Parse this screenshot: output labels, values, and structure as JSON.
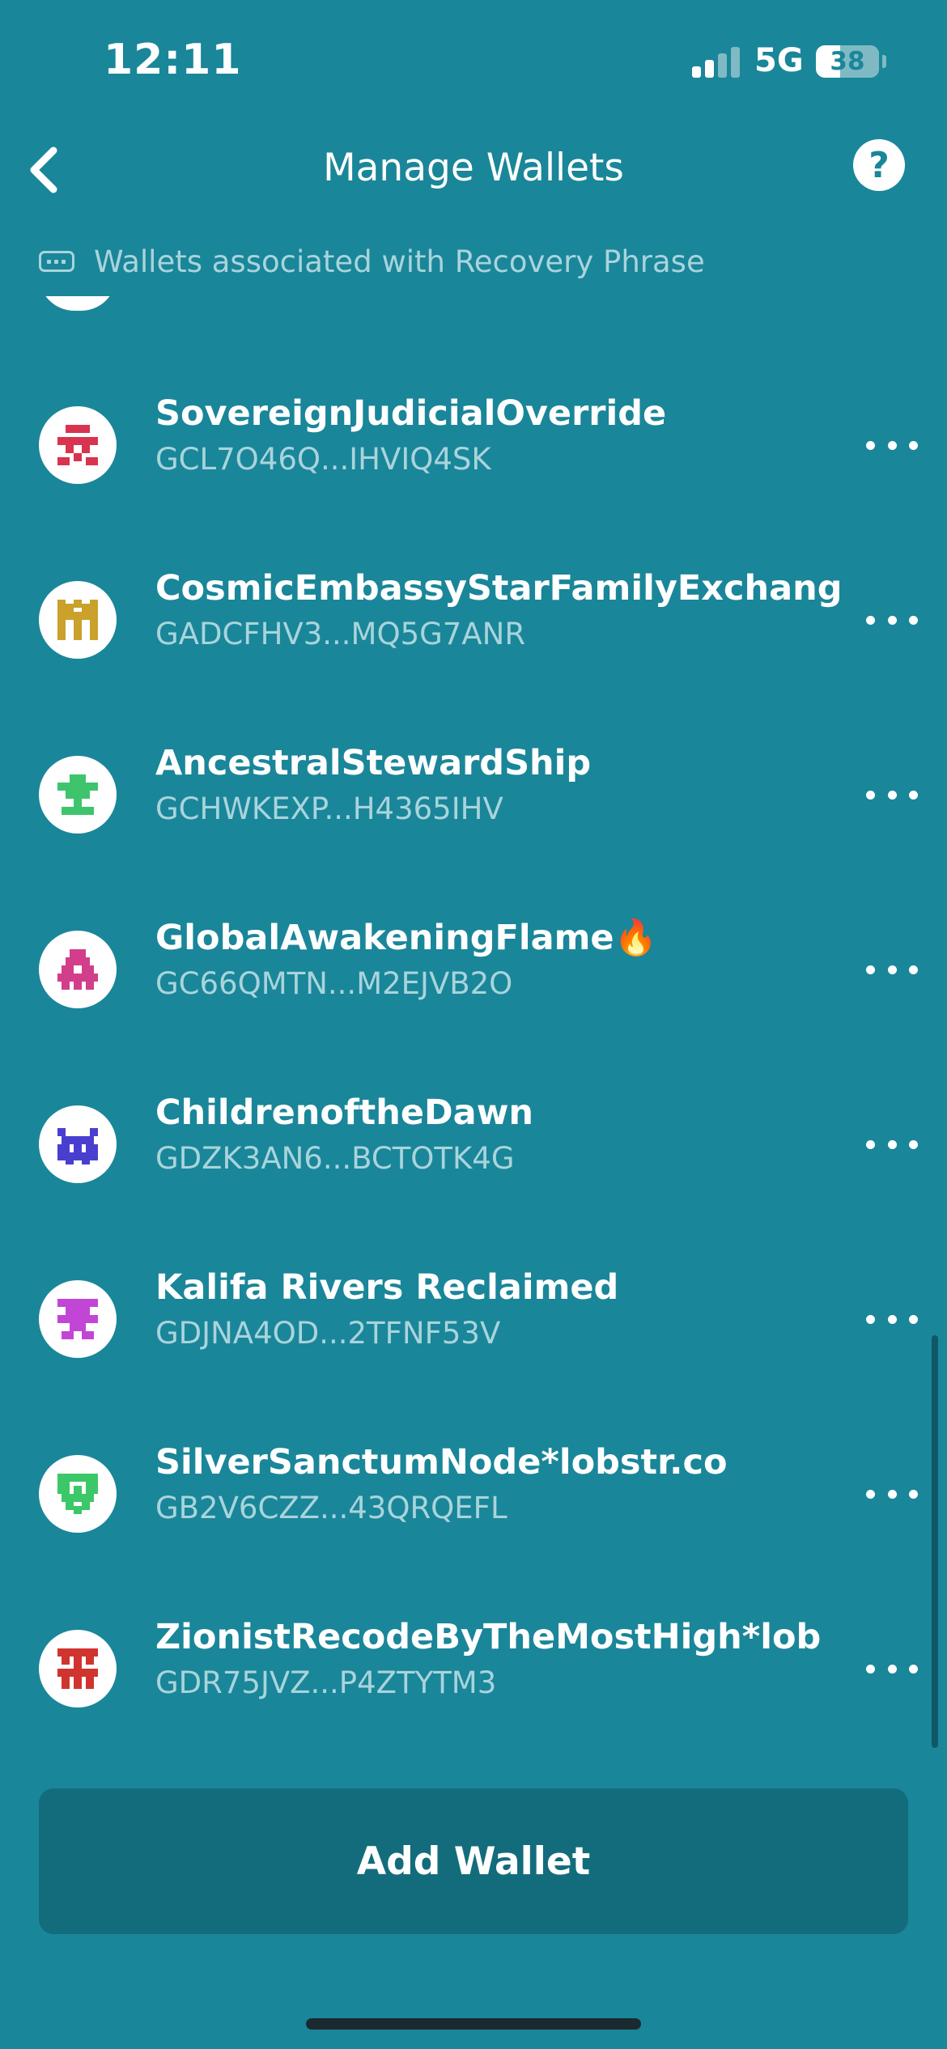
{
  "status_bar": {
    "time": "12:11",
    "network": "5G",
    "battery": "38",
    "signal_bars_active": 2
  },
  "nav": {
    "title": "Manage Wallets",
    "back_icon": "chevron-left-icon",
    "help_label": "?"
  },
  "section": {
    "header": "Wallets associated with Recovery Phrase",
    "icon": "recovery-phrase-icon"
  },
  "wallets": [
    {
      "name": "SovereignJudicialOverride",
      "address": "GCL7O46Q...IHVIQ4SK",
      "avatar_color": "#d9344f",
      "avatar_icon": "pixel-invader-icon"
    },
    {
      "name": "CosmicEmbassyStarFamilyExchang",
      "address": "GADCFHV3...MQ5G7ANR",
      "avatar_color": "#c9a12b",
      "avatar_icon": "pixel-invader-icon"
    },
    {
      "name": "AncestralStewardShip",
      "address": "GCHWKEXP...H4365IHV",
      "avatar_color": "#3ec46d",
      "avatar_icon": "pixel-invader-icon"
    },
    {
      "name": "GlobalAwakeningFlame🔥",
      "address": "GC66QMTN...M2EJVB2O",
      "avatar_color": "#d23e8a",
      "avatar_icon": "pixel-invader-icon"
    },
    {
      "name": "ChildrenoftheDawn",
      "address": "GDZK3AN6...BCTOTK4G",
      "avatar_color": "#4a3ed1",
      "avatar_icon": "pixel-invader-icon"
    },
    {
      "name": "Kalifa Rivers Reclaimed",
      "address": "GDJNA4OD...2TFNF53V",
      "avatar_color": "#c246d6",
      "avatar_icon": "pixel-invader-icon"
    },
    {
      "name": "SilverSanctumNode*lobstr.co",
      "address": "GB2V6CZZ...43QRQEFL",
      "avatar_color": "#3cc768",
      "avatar_icon": "pixel-invader-icon"
    },
    {
      "name": "ZionistRecodeByTheMostHigh*lob",
      "address": "GDR75JVZ...P4ZTYTM3",
      "avatar_color": "#d0342f",
      "avatar_icon": "pixel-invader-icon"
    }
  ],
  "actions": {
    "add_wallet_label": "Add Wallet",
    "more_icon": "more-horizontal-icon"
  }
}
